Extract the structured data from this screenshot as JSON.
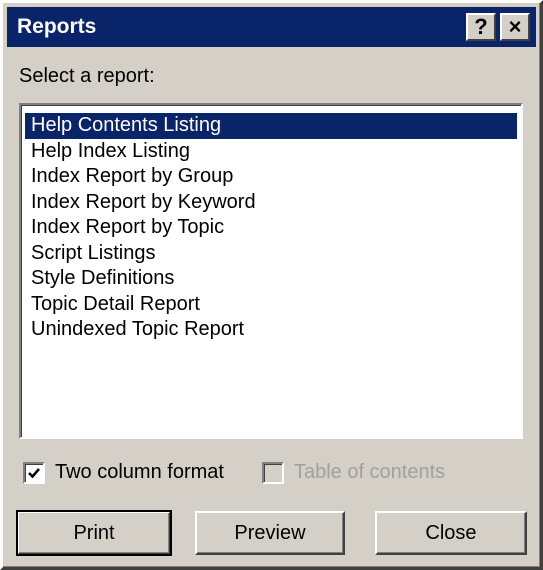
{
  "window": {
    "title": "Reports",
    "help_button": "?",
    "close_button": "×"
  },
  "prompt": "Select a report:",
  "reports": {
    "items": [
      "Help Contents Listing",
      "Help Index Listing",
      "Index Report by Group",
      "Index Report by Keyword",
      "Index Report by Topic",
      "Script Listings",
      "Style Definitions",
      "Topic Detail Report",
      "Unindexed Topic Report"
    ],
    "selected": "Help Contents Listing"
  },
  "options": {
    "two_column": {
      "label": "Two column format",
      "checked": true,
      "enabled": true
    },
    "toc": {
      "label": "Table of contents",
      "checked": false,
      "enabled": false
    }
  },
  "buttons": {
    "print": "Print",
    "preview": "Preview",
    "close": "Close"
  },
  "colors": {
    "titlebar": "#0a246a",
    "selection": "#0a246a",
    "face": "#d4d0c8"
  }
}
